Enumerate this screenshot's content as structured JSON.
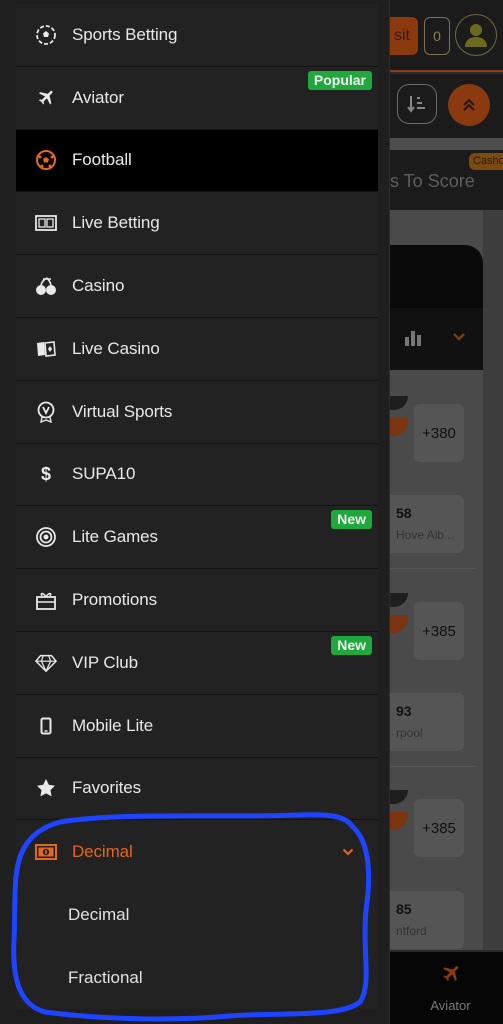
{
  "drawer": {
    "items": [
      {
        "label": "Sports Betting",
        "icon": "sports-ball-icon",
        "badge": null,
        "active": false
      },
      {
        "label": "Aviator",
        "icon": "airplane-icon",
        "badge": "Popular",
        "active": false
      },
      {
        "label": "Football",
        "icon": "football-icon",
        "badge": null,
        "active": true
      },
      {
        "label": "Live Betting",
        "icon": "scoreboard-icon",
        "badge": null,
        "active": false
      },
      {
        "label": "Casino",
        "icon": "cherries-icon",
        "badge": null,
        "active": false
      },
      {
        "label": "Live Casino",
        "icon": "playing-cards-icon",
        "badge": null,
        "active": false
      },
      {
        "label": "Virtual Sports",
        "icon": "virtual-medal-icon",
        "badge": null,
        "active": false
      },
      {
        "label": "SUPA10",
        "icon": "dollar-icon",
        "badge": null,
        "active": false
      },
      {
        "label": "Lite Games",
        "icon": "target-icon",
        "badge": "New",
        "active": false
      },
      {
        "label": "Promotions",
        "icon": "gift-icon",
        "badge": null,
        "active": false
      },
      {
        "label": "VIP Club",
        "icon": "diamond-icon",
        "badge": "New",
        "active": false
      },
      {
        "label": "Mobile Lite",
        "icon": "mobile-phone-icon",
        "badge": null,
        "active": false
      },
      {
        "label": "Favorites",
        "icon": "star-icon",
        "badge": null,
        "active": false
      }
    ],
    "odds_format": {
      "selected": "Decimal",
      "icon": "banknote-icon",
      "expanded": true,
      "options": [
        "Decimal",
        "Fractional"
      ]
    }
  },
  "background": {
    "deposit_label": "sit",
    "bet_count": "0",
    "market_title": "ns To Score",
    "cashout_badge": "Cashou",
    "matches": [
      {
        "odds": "+380",
        "sub_value": "58",
        "sub_text": "Hove Alb..."
      },
      {
        "odds": "+385",
        "sub_value": "93",
        "sub_text": "rpool"
      },
      {
        "odds": "+385",
        "sub_value": "85",
        "sub_text": "ntford"
      }
    ],
    "bottom_nav_label": "Aviator"
  },
  "colors": {
    "accent": "#e4671e",
    "badge_green": "#1fa83c",
    "drawer_bg": "#222222",
    "active_bg": "#000000",
    "annotation": "#1f44ff"
  }
}
